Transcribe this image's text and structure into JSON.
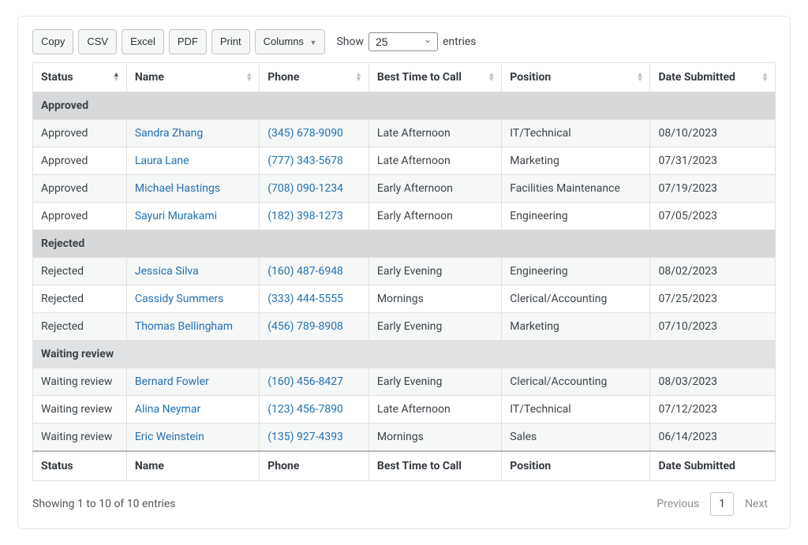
{
  "toolbar": {
    "copy": "Copy",
    "csv": "CSV",
    "excel": "Excel",
    "pdf": "PDF",
    "print": "Print",
    "columns": "Columns"
  },
  "length_menu": {
    "show": "Show",
    "value": "25",
    "entries": "entries"
  },
  "columns": {
    "status": "Status",
    "name": "Name",
    "phone": "Phone",
    "best_time": "Best Time to Call",
    "position": "Position",
    "date": "Date Submitted"
  },
  "groups": [
    {
      "label": "Approved",
      "rows": [
        {
          "status": "Approved",
          "name": "Sandra Zhang",
          "phone": "(345) 678-9090",
          "best_time": "Late Afternoon",
          "position": "IT/Technical",
          "date": "08/10/2023"
        },
        {
          "status": "Approved",
          "name": "Laura Lane",
          "phone": "(777) 343-5678",
          "best_time": "Late Afternoon",
          "position": "Marketing",
          "date": "07/31/2023"
        },
        {
          "status": "Approved",
          "name": "Michael Hastings",
          "phone": "(708) 090-1234",
          "best_time": "Early Afternoon",
          "position": "Facilities Maintenance",
          "date": "07/19/2023"
        },
        {
          "status": "Approved",
          "name": "Sayuri Murakami",
          "phone": "(182) 398-1273",
          "best_time": "Early Afternoon",
          "position": "Engineering",
          "date": "07/05/2023"
        }
      ]
    },
    {
      "label": "Rejected",
      "rows": [
        {
          "status": "Rejected",
          "name": "Jessica Silva",
          "phone": "(160) 487-6948",
          "best_time": "Early Evening",
          "position": "Engineering",
          "date": "08/02/2023"
        },
        {
          "status": "Rejected",
          "name": "Cassidy Summers",
          "phone": "(333) 444-5555",
          "best_time": "Mornings",
          "position": "Clerical/Accounting",
          "date": "07/25/2023"
        },
        {
          "status": "Rejected",
          "name": "Thomas Bellingham",
          "phone": "(456) 789-8908",
          "best_time": "Early Evening",
          "position": "Marketing",
          "date": "07/10/2023"
        }
      ]
    },
    {
      "label": "Waiting review",
      "rows": [
        {
          "status": "Waiting review",
          "name": "Bernard Fowler",
          "phone": "(160) 456-8427",
          "best_time": "Early Evening",
          "position": "Clerical/Accounting",
          "date": "08/03/2023"
        },
        {
          "status": "Waiting review",
          "name": "Alina Neymar",
          "phone": "(123) 456-7890",
          "best_time": "Late Afternoon",
          "position": "IT/Technical",
          "date": "07/12/2023"
        },
        {
          "status": "Waiting review",
          "name": "Eric Weinstein",
          "phone": "(135) 927-4393",
          "best_time": "Mornings",
          "position": "Sales",
          "date": "06/14/2023"
        }
      ]
    }
  ],
  "info": "Showing 1 to 10 of 10 entries",
  "pagination": {
    "previous": "Previous",
    "page1": "1",
    "next": "Next"
  }
}
